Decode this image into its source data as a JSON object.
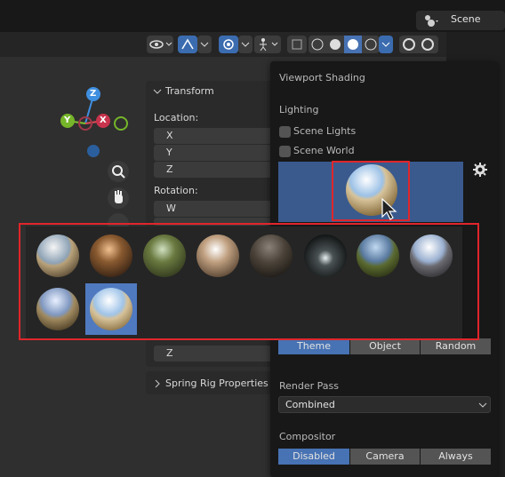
{
  "header": {
    "scene_label": "Scene"
  },
  "transform_panel": {
    "title": "Transform",
    "location_label": "Location:",
    "location_fields": [
      "X",
      "Y",
      "Z"
    ],
    "rotation_label": "Rotation:",
    "rotation_fields": [
      "W"
    ],
    "bottom_field": "Z"
  },
  "spring_rig": {
    "title": "Spring Rig Properties"
  },
  "gizmo": {
    "z": "Z",
    "x": "X",
    "y": "Y"
  },
  "shading_popover": {
    "title": "Viewport Shading",
    "lighting_label": "Lighting",
    "scene_lights_label": "Scene Lights",
    "scene_world_label": "Scene World",
    "color_options": [
      "Theme",
      "Object",
      "Random"
    ],
    "color_selected": "Theme",
    "render_pass_label": "Render Pass",
    "render_pass_value": "Combined",
    "compositor_label": "Compositor",
    "compositor_options": [
      "Disabled",
      "Camera",
      "Always"
    ],
    "compositor_selected": "Disabled"
  },
  "hdri_grid": {
    "count": 10,
    "selected_index": 9
  },
  "colors": {
    "accent": "#4772b3",
    "highlight": "#e0262b",
    "axis_x": "#e04858",
    "axis_y": "#7fbf2f",
    "axis_z": "#3f8fe0"
  }
}
